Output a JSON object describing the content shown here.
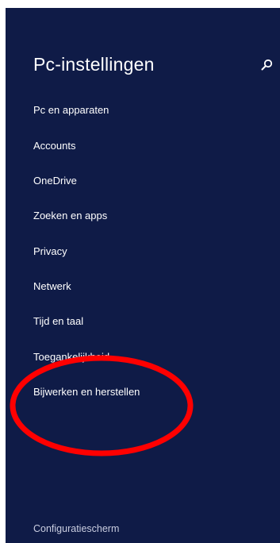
{
  "panel": {
    "title": "Pc-instellingen",
    "background_color": "#0f1b47",
    "search_icon": "search-icon"
  },
  "nav": {
    "items": [
      {
        "label": "Pc en apparaten"
      },
      {
        "label": "Accounts"
      },
      {
        "label": "OneDrive"
      },
      {
        "label": "Zoeken en apps"
      },
      {
        "label": "Privacy"
      },
      {
        "label": "Netwerk"
      },
      {
        "label": "Tijd en taal"
      },
      {
        "label": "Toegankelijkheid"
      },
      {
        "label": "Bijwerken en herstellen"
      }
    ]
  },
  "footer": {
    "label": "Configuratiescherm"
  },
  "annotation": {
    "color": "#ff0000"
  }
}
